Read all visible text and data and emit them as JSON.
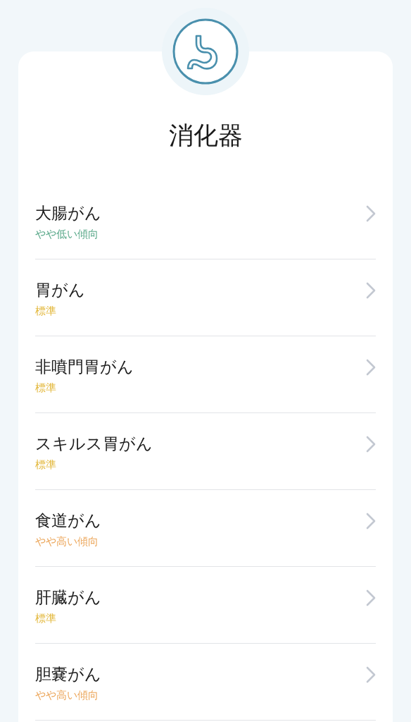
{
  "title": "消化器",
  "items": [
    {
      "name": "大腸がん",
      "status": "やや低い傾向",
      "color": "#5aa98a"
    },
    {
      "name": "胃がん",
      "status": "標準",
      "color": "#e3b83c"
    },
    {
      "name": "非噴門胃がん",
      "status": "標準",
      "color": "#e3b83c"
    },
    {
      "name": "スキルス胃がん",
      "status": "標準",
      "color": "#e3b83c"
    },
    {
      "name": "食道がん",
      "status": "やや高い傾向",
      "color": "#eca75c"
    },
    {
      "name": "肝臓がん",
      "status": "標準",
      "color": "#e3b83c"
    },
    {
      "name": "胆嚢がん",
      "status": "やや高い傾向",
      "color": "#eca75c"
    }
  ]
}
